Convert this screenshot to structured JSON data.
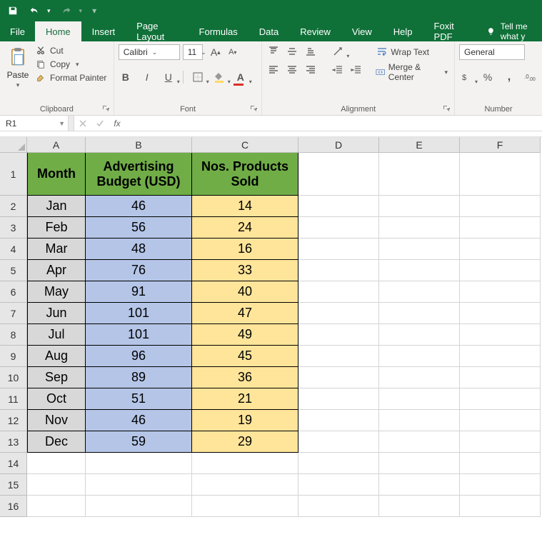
{
  "qat": {
    "undo_title": "Undo",
    "redo_title": "Redo",
    "save_title": "Save"
  },
  "tabs": {
    "file": "File",
    "home": "Home",
    "insert": "Insert",
    "page_layout": "Page Layout",
    "formulas": "Formulas",
    "data": "Data",
    "review": "Review",
    "view": "View",
    "help": "Help",
    "foxit": "Foxit PDF",
    "tell_me": "Tell me what y"
  },
  "ribbon": {
    "clipboard": {
      "paste": "Paste",
      "cut": "Cut",
      "copy": "Copy",
      "format_painter": "Format Painter",
      "label": "Clipboard"
    },
    "font": {
      "name": "Calibri",
      "size": "11",
      "label": "Font"
    },
    "alignment": {
      "wrap": "Wrap Text",
      "merge": "Merge & Center",
      "label": "Alignment"
    },
    "number": {
      "format": "General",
      "label": "Number"
    }
  },
  "namebox": "R1",
  "formula": "",
  "columns": [
    "A",
    "B",
    "C",
    "D",
    "E",
    "F"
  ],
  "headers": {
    "month": "Month",
    "budget": "Advertising Budget (USD)",
    "sold": "Nos. Products Sold"
  },
  "rows": [
    {
      "n": 1
    },
    {
      "n": 2,
      "month": "Jan",
      "budget": 46,
      "sold": 14
    },
    {
      "n": 3,
      "month": "Feb",
      "budget": 56,
      "sold": 24
    },
    {
      "n": 4,
      "month": "Mar",
      "budget": 48,
      "sold": 16
    },
    {
      "n": 5,
      "month": "Apr",
      "budget": 76,
      "sold": 33
    },
    {
      "n": 6,
      "month": "May",
      "budget": 91,
      "sold": 40
    },
    {
      "n": 7,
      "month": "Jun",
      "budget": 101,
      "sold": 47
    },
    {
      "n": 8,
      "month": "Jul",
      "budget": 101,
      "sold": 49
    },
    {
      "n": 9,
      "month": "Aug",
      "budget": 96,
      "sold": 45
    },
    {
      "n": 10,
      "month": "Sep",
      "budget": 89,
      "sold": 36
    },
    {
      "n": 11,
      "month": "Oct",
      "budget": 51,
      "sold": 21
    },
    {
      "n": 12,
      "month": "Nov",
      "budget": 46,
      "sold": 19
    },
    {
      "n": 13,
      "month": "Dec",
      "budget": 59,
      "sold": 29
    },
    {
      "n": 14
    },
    {
      "n": 15
    },
    {
      "n": 16
    }
  ],
  "chart_data": {
    "type": "table",
    "title": "Advertising Budget vs Products Sold by Month",
    "categories": [
      "Jan",
      "Feb",
      "Mar",
      "Apr",
      "May",
      "Jun",
      "Jul",
      "Aug",
      "Sep",
      "Oct",
      "Nov",
      "Dec"
    ],
    "series": [
      {
        "name": "Advertising Budget (USD)",
        "values": [
          46,
          56,
          48,
          76,
          91,
          101,
          101,
          96,
          89,
          51,
          46,
          59
        ]
      },
      {
        "name": "Nos. Products Sold",
        "values": [
          14,
          24,
          16,
          33,
          40,
          47,
          49,
          45,
          36,
          21,
          19,
          29
        ]
      }
    ]
  }
}
